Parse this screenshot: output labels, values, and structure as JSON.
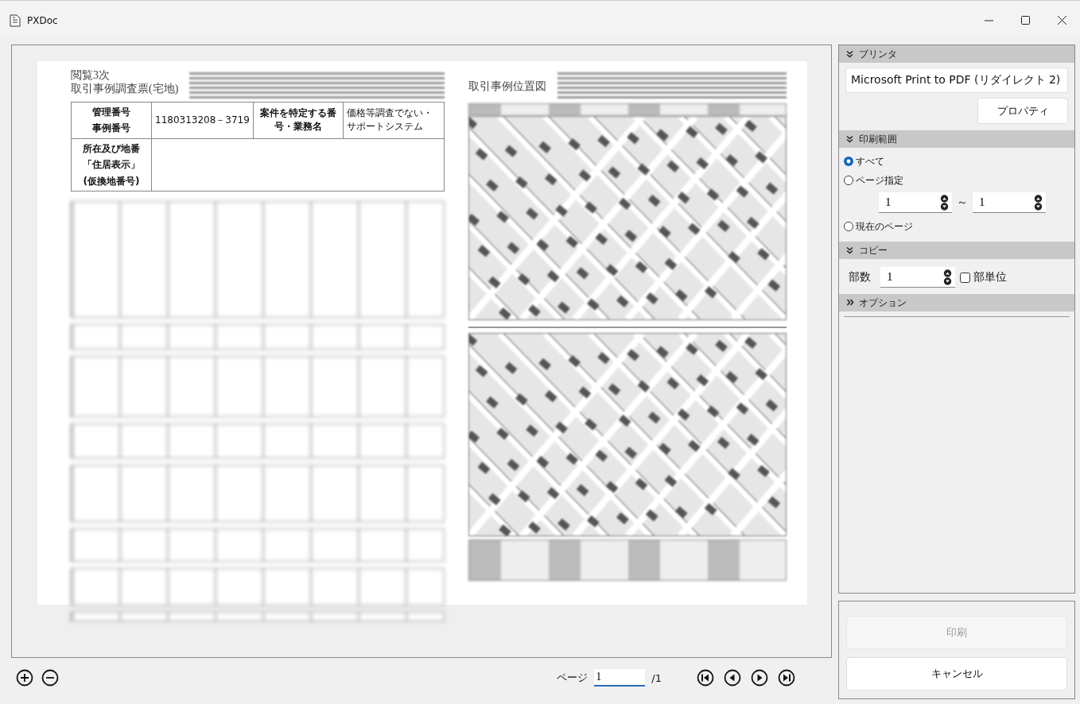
{
  "window": {
    "title": "PXDoc"
  },
  "preview": {
    "pages": [
      {
        "kind": "form",
        "heading": [
          "閲覧3次",
          "取引事例調査票(宅地)"
        ],
        "rows": [
          {
            "labels": [
              "管理番号",
              "事例番号"
            ],
            "value": "1180313208－3719",
            "label2": "案件を特定する番号・業務名",
            "value2": "価格等調査でない・サポートシステム"
          },
          {
            "labels": [
              "所在及び地番",
              "「住居表示」",
              "(仮換地番号)"
            ]
          }
        ]
      },
      {
        "kind": "map",
        "heading": "取引事例位置図"
      }
    ]
  },
  "pager": {
    "label": "ページ",
    "value": "1",
    "total": "/1"
  },
  "panel": {
    "sections": [
      {
        "kind": "printer",
        "title": "プリンタ",
        "expanded": true,
        "printer": "Microsoft Print to PDF (リダイレクト 2)",
        "button": "プロパティ"
      },
      {
        "kind": "range",
        "title": "印刷範囲",
        "expanded": true,
        "options": [
          {
            "label": "すべて",
            "selected": true
          },
          {
            "label": "ページ指定",
            "selected": false,
            "range": {
              "from": "1",
              "separator": "～",
              "to": "1"
            }
          },
          {
            "label": "現在のページ",
            "selected": false
          }
        ]
      },
      {
        "kind": "copies",
        "title": "コピー",
        "expanded": true,
        "label": "部数",
        "value": "1",
        "collate": {
          "label": "部単位",
          "checked": false
        }
      },
      {
        "kind": "options",
        "title": "オプション",
        "expanded": false
      }
    ]
  },
  "actions": [
    {
      "label": "印刷",
      "disabled": true
    },
    {
      "label": "キャンセル",
      "disabled": false
    }
  ]
}
